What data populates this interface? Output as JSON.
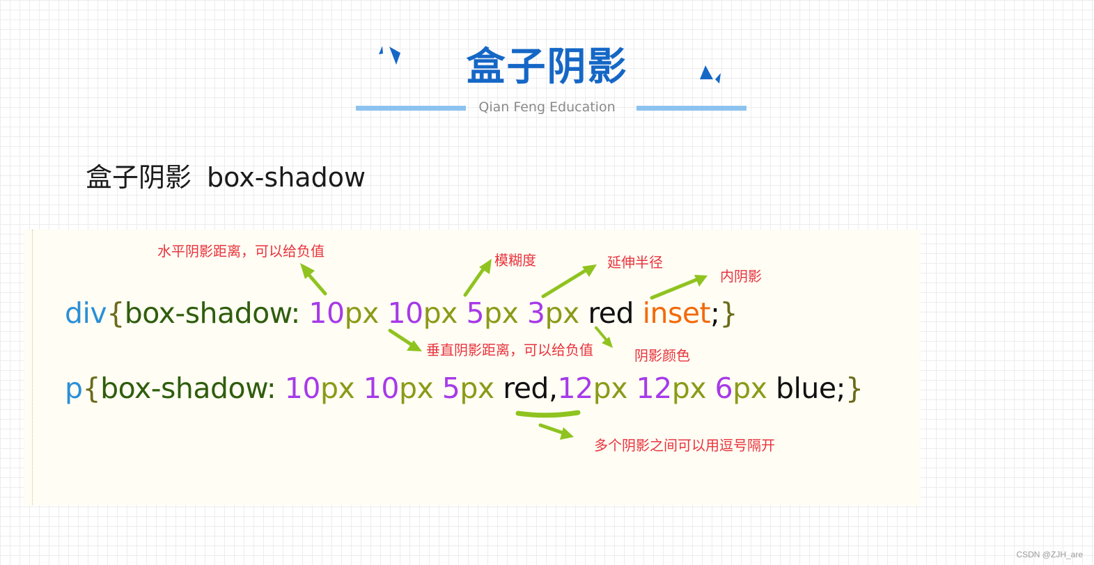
{
  "header": {
    "title": "盒子阴影",
    "subtitle": "Qian Feng Education"
  },
  "heading": {
    "zh": "盒子阴影",
    "en": "box-shadow"
  },
  "code": {
    "line1": {
      "selector": "div",
      "open": "{",
      "property": "box-shadow:",
      "v1n": "10",
      "v1u": "px",
      "v2n": "10",
      "v2u": "px",
      "v3n": "5",
      "v3u": "px",
      "v4n": "3",
      "v4u": "px",
      "color": "red",
      "inset": "inset",
      "semi": ";",
      "close": "}"
    },
    "line2": {
      "selector": "p",
      "open": "{",
      "property": "box-shadow:",
      "v1n": "10",
      "v1u": "px",
      "v2n": "10",
      "v2u": "px",
      "v3n": "5",
      "v3u": "px",
      "color1": "red",
      "comma": ",",
      "v4n": "12",
      "v4u": "px",
      "v5n": "12",
      "v5u": "px",
      "v6n": "6",
      "v6u": "px",
      "color2": "blue",
      "semi": ";",
      "close": "}"
    }
  },
  "notes": {
    "horizontal": "水平阴影距离，可以给负值",
    "blur": "模糊度",
    "spread": "延伸半径",
    "inner": "内阴影",
    "vertical": "垂直阴影距离，可以给负值",
    "shadow_color": "阴影颜色",
    "multiple": "多个阴影之间可以用逗号隔开"
  },
  "watermark": "CSDN @ZJH_are",
  "colors": {
    "title_blue": "#1567c6",
    "rule_blue": "#8cc2ef",
    "note_red": "#e8323c",
    "arrow_green": "#8fc31f",
    "number_purple": "#a63ae8",
    "unit_olive": "#8b9a17",
    "selector_blue": "#2b8fd6",
    "property_green": "#2f5d0d",
    "inset_orange": "#f26a0c"
  }
}
